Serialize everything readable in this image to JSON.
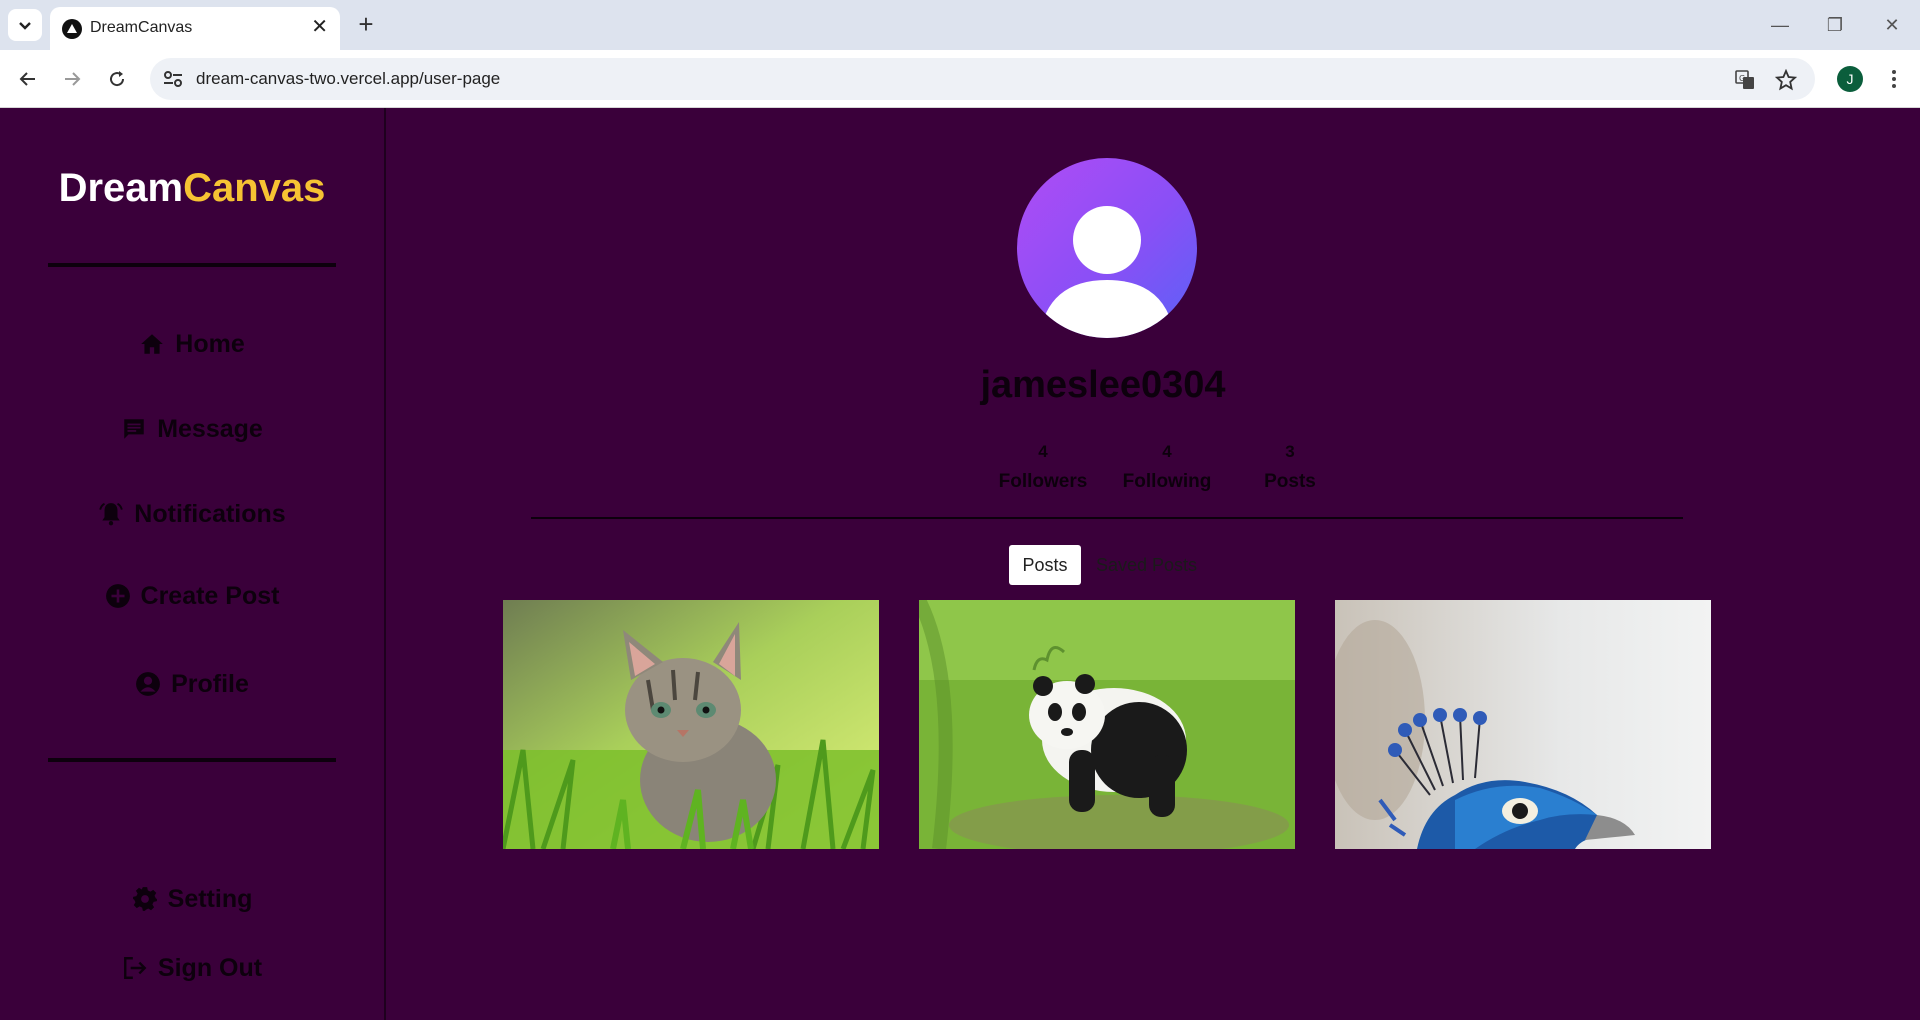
{
  "browser": {
    "tab_title": "DreamCanvas",
    "url": "dream-canvas-two.vercel.app/user-page",
    "profile_initial": "J"
  },
  "sidebar": {
    "logo_part1": "Dream",
    "logo_part2": "Canvas",
    "items": [
      {
        "label": "Home",
        "icon": "home-icon"
      },
      {
        "label": "Message",
        "icon": "message-icon"
      },
      {
        "label": "Notifications",
        "icon": "bell-icon"
      },
      {
        "label": "Create Post",
        "icon": "plus-circle-icon"
      },
      {
        "label": "Profile",
        "icon": "user-circle-icon"
      }
    ],
    "bottom_items": [
      {
        "label": "Setting",
        "icon": "gear-icon"
      },
      {
        "label": "Sign Out",
        "icon": "sign-out-icon"
      }
    ]
  },
  "profile": {
    "username": "jameslee0304",
    "stats": [
      {
        "value": "4",
        "label": "Followers"
      },
      {
        "value": "4",
        "label": "Following"
      },
      {
        "value": "3",
        "label": "Posts"
      }
    ],
    "tabs": [
      "Posts",
      "Saved Posts"
    ],
    "posts": [
      {
        "subject": "kitten in grass"
      },
      {
        "subject": "panda on grass"
      },
      {
        "subject": "peacock head"
      }
    ]
  },
  "colors": {
    "background": "#3a003a",
    "logo_accent": "#f6c333",
    "avatar_gradient_start": "#b04cf5",
    "avatar_gradient_end": "#5a62f7"
  }
}
